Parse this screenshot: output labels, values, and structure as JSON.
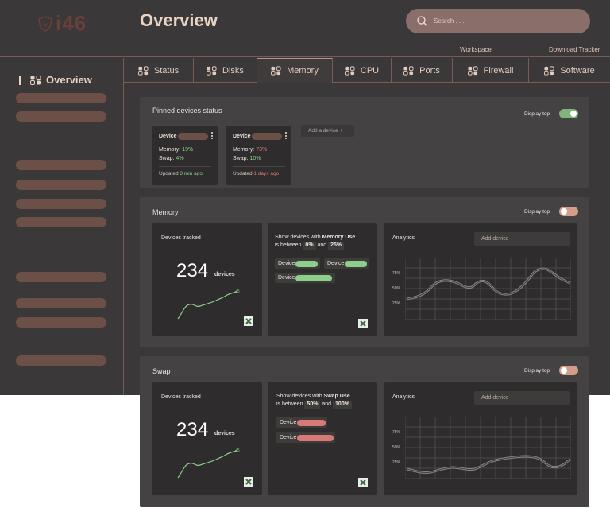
{
  "app": {
    "logo": "i46",
    "title": "Overview"
  },
  "search": {
    "placeholder": "Search . . ."
  },
  "subnav": {
    "workspace": "Workspace",
    "download": "Download Tracker"
  },
  "sidebar": {
    "header": "Overview",
    "item_count": 9
  },
  "tabs": [
    {
      "label": "Status"
    },
    {
      "label": "Disks"
    },
    {
      "label": "Memory",
      "active": true
    },
    {
      "label": "CPU"
    },
    {
      "label": "Ports"
    },
    {
      "label": "Firewall"
    },
    {
      "label": "Software"
    }
  ],
  "pinned": {
    "title": "Pinned devices status",
    "display_top": "Display top",
    "display_top_on": true,
    "add_device": "Add a device +",
    "devices": [
      {
        "label": "Device",
        "memory_label": "Memory:",
        "memory": "19%",
        "swap_label": "Swap:",
        "swap": "4%",
        "updated_label": "Updated",
        "updated": "3 min ago",
        "status": "ok"
      },
      {
        "label": "Device",
        "memory_label": "Memory:",
        "memory": "73%",
        "swap_label": "Swap:",
        "swap": "10%",
        "updated_label": "Updated",
        "updated": "1 days ago",
        "status": "warn"
      }
    ]
  },
  "memory": {
    "title": "Memory",
    "display_top": "Display top",
    "display_top_on": false,
    "tracked": {
      "title": "Devices tracked",
      "count": "234",
      "unit": "devices",
      "delta": "+5"
    },
    "filter": {
      "line1_prefix": "Show devices with",
      "metric": "Memory Use",
      "line2_prefix": "is between",
      "low": "0%",
      "and": "and",
      "high": "25%",
      "chips": [
        "Device",
        "Device",
        "Device"
      ]
    },
    "analytics": {
      "title": "Analytics",
      "add": "Add device +",
      "yticks": [
        "75%",
        "50%",
        "25%"
      ]
    }
  },
  "swap": {
    "title": "Swap",
    "display_top": "Display top",
    "display_top_on": false,
    "tracked": {
      "title": "Devices tracked",
      "count": "234",
      "unit": "devices",
      "delta": "+5"
    },
    "filter": {
      "line1_prefix": "Show devices with",
      "metric": "Swap Use",
      "line2_prefix": "is between",
      "low": "50%",
      "and": "and",
      "high": "100%",
      "chips": [
        "Device",
        "Device"
      ]
    },
    "analytics": {
      "title": "Analytics",
      "add": "Add device +",
      "yticks": [
        "75%",
        "50%",
        "25%"
      ]
    }
  },
  "colors": {
    "accent": "#e6c9b9",
    "ok": "#8ccf8b",
    "warn": "#d77a77",
    "placeholder_pill": "#6c5047"
  }
}
